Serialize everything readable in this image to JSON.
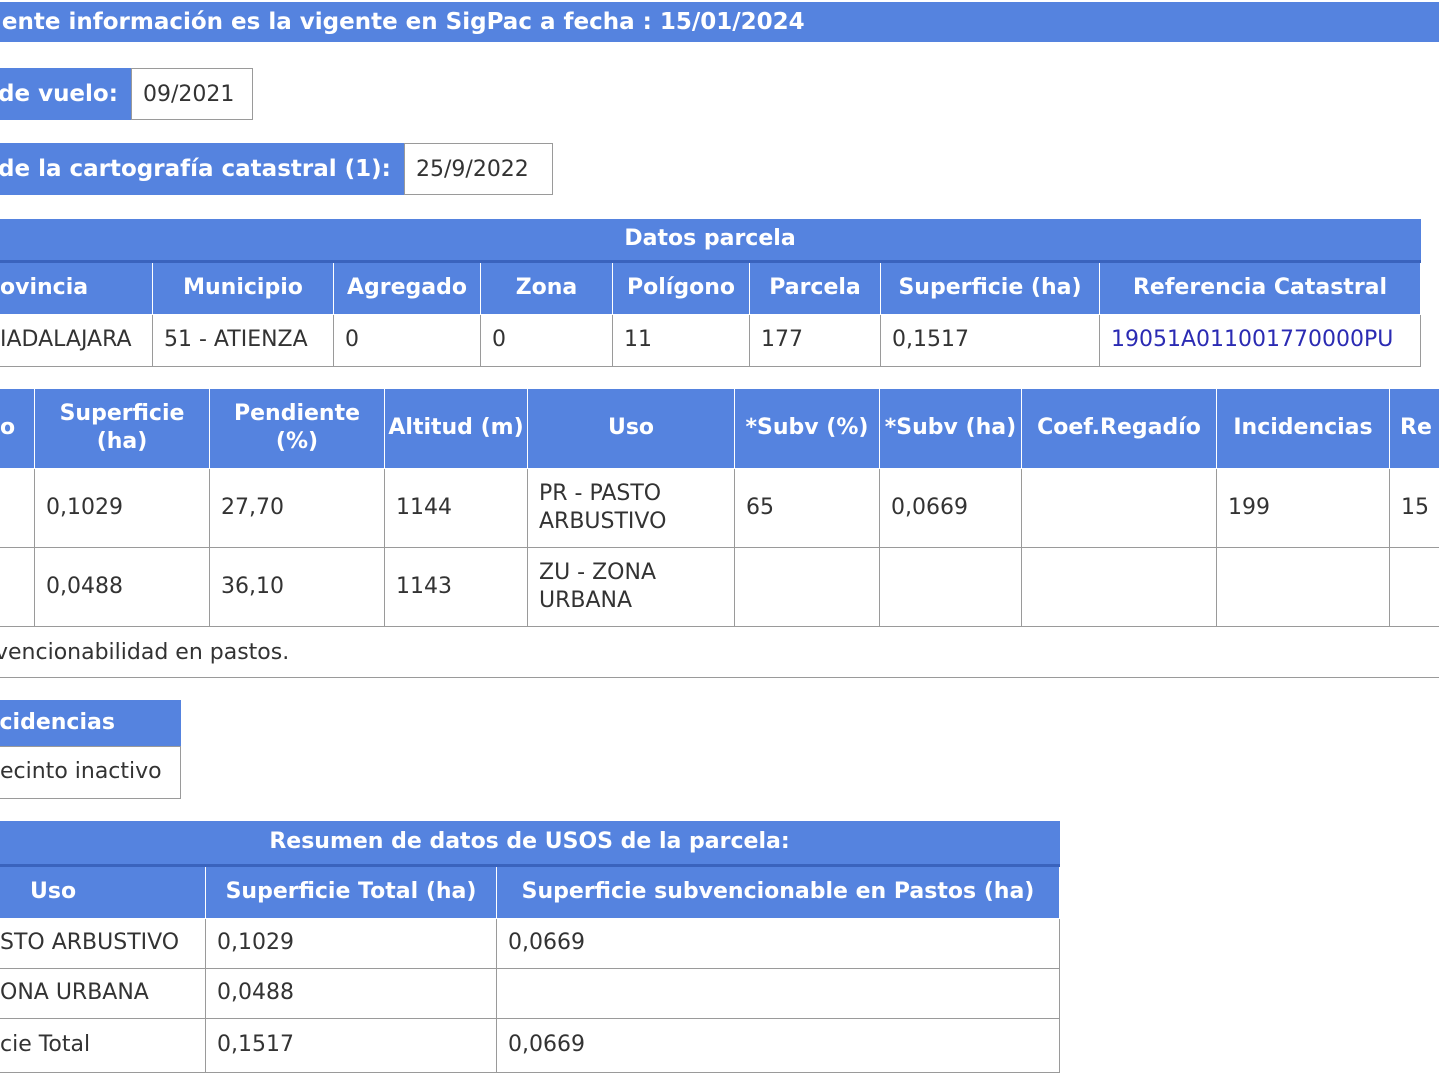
{
  "banner": {
    "text": "iente información es la vigente en SigPac a fecha : 15/01/2024"
  },
  "vuelo": {
    "label": "de vuelo:",
    "value": "09/2021"
  },
  "catastro": {
    "label": "de la cartografía catastral (1):",
    "value": "25/9/2022"
  },
  "parcela": {
    "caption": "Datos parcela",
    "headers": [
      "ovincia",
      "Municipio",
      "Agregado",
      "Zona",
      "Polígono",
      "Parcela",
      "Superficie (ha)",
      "Referencia Catastral"
    ],
    "row": [
      "IADALAJARA",
      "51 - ATIENZA",
      "0",
      "0",
      "11",
      "177",
      "0,1517",
      "19051A011001770000PU"
    ]
  },
  "recintos": {
    "headers": [
      "o",
      "Superficie (ha)",
      "Pendiente (%)",
      "Altitud (m)",
      "Uso",
      "*Subv (%)",
      "*Subv (ha)",
      "Coef.Regadío",
      "Incidencias",
      "Re"
    ],
    "rows": [
      [
        "",
        "0,1029",
        "27,70",
        "1144",
        "PR - PASTO ARBUSTIVO",
        "65",
        "0,0669",
        "",
        "199",
        "15"
      ],
      [
        "",
        "0,0488",
        "36,10",
        "1143",
        "ZU - ZONA URBANA",
        "",
        "",
        "",
        "",
        ""
      ]
    ]
  },
  "note": {
    "text": "vencionabilidad en pastos."
  },
  "incidencias": {
    "header": "cidencias",
    "value": "ecinto inactivo"
  },
  "resumen": {
    "caption": "Resumen de datos de USOS de la parcela:",
    "headers": [
      "Uso",
      "Superficie Total (ha)",
      "Superficie subvencionable en Pastos (ha)"
    ],
    "rows": [
      [
        "STO ARBUSTIVO",
        "0,1029",
        "0,0669"
      ],
      [
        "ONA URBANA",
        "0,0488",
        ""
      ],
      [
        "cie Total",
        "0,1517",
        "0,0669"
      ]
    ]
  }
}
